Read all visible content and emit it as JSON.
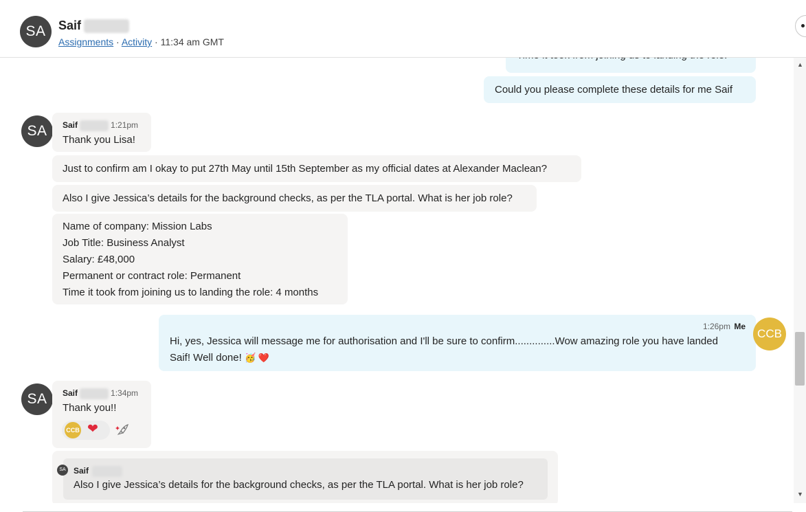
{
  "header": {
    "avatar_initials": "SA",
    "name": "Saif",
    "link_assignments": "Assignments",
    "sep1": " · ",
    "link_activity": "Activity",
    "time": " · 11:34 am GMT"
  },
  "messages": {
    "m1_text": "Time it took from joining us to landing the role.",
    "m2_text": "Could you please complete these details for me Saif",
    "g1_sender": "Saif",
    "g1_time": "1:21pm",
    "g1_text": "Thank you Lisa!",
    "g1_b2": "Just to confirm am I okay to put 27th May until 15th September as my official dates at Alexander Maclean?",
    "g1_b3": "Also I give Jessica’s details for the background checks, as per the TLA portal. What is her job role?",
    "g1_b4_lines": [
      "Name of company: Mission Labs",
      "Job Title: Business Analyst",
      "Salary: £48,000",
      "Permanent or contract role: Permanent",
      "Time it took from joining us to landing the role: 4 months"
    ],
    "me_time": "1:26pm",
    "me_label": "Me",
    "me_avatar": "CCB",
    "me_text_line1": "Hi, yes, Jessica will message me for authorisation and I'll be sure to confirm..............Wow amazing role you have landed",
    "me_text_line2": "Saif! Well done! ",
    "me_emoji": "🥳 ❤️",
    "g2_sender": "Saif",
    "g2_time": "1:34pm",
    "g2_text": "Thank you!!",
    "reaction_ccb": "CCB",
    "reaction_heart": "❤",
    "quote_avatar": "SA",
    "quote_sender": "Saif",
    "quote_text": "Also I give Jessica’s details for the background checks, as per the TLA portal. What is her job role?"
  },
  "colors": {
    "me_bubble": "#e8f6fb",
    "them_bubble": "#f5f4f3",
    "ccb_avatar": "#e3b93d",
    "sa_avatar": "#444444",
    "link": "#2b6cb0"
  }
}
